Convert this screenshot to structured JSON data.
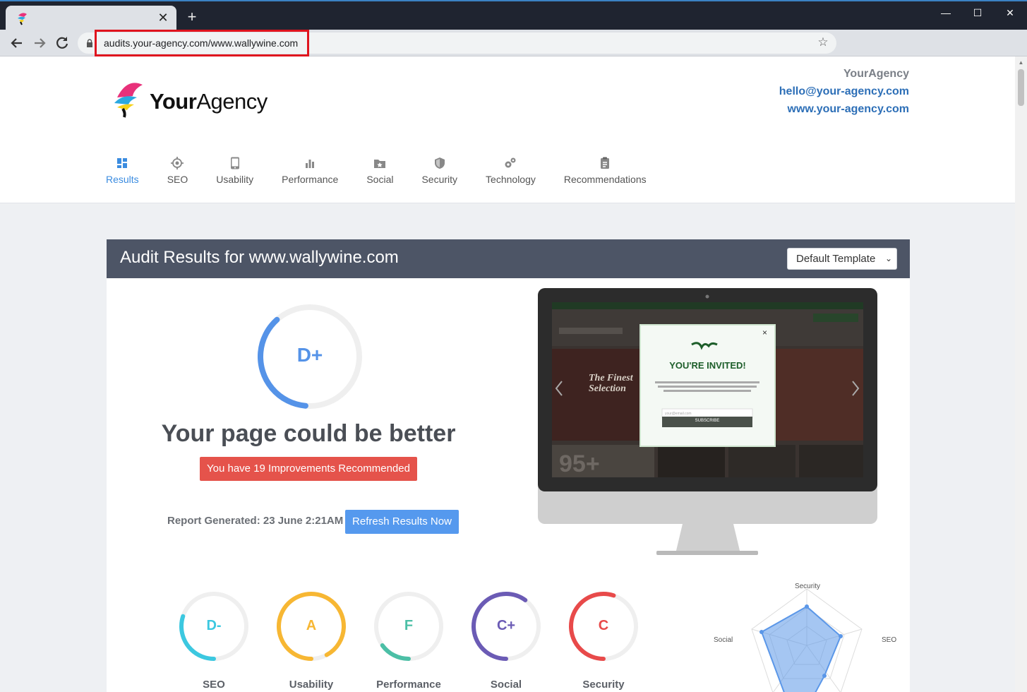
{
  "browser": {
    "url": "audits.your-agency.com/www.wallywine.com",
    "tab_close": "✕",
    "new_tab": "+",
    "window_minimize": "—",
    "window_maximize": "☐",
    "window_close": "✕"
  },
  "agency": {
    "logo_text_bold": "Your",
    "logo_text_light": "Agency",
    "name": "YourAgency",
    "email": "hello@your-agency.com",
    "website": "www.your-agency.com"
  },
  "nav": [
    {
      "label": "Results",
      "icon": "dashboard-icon",
      "active": true
    },
    {
      "label": "SEO",
      "icon": "target-icon"
    },
    {
      "label": "Usability",
      "icon": "tablet-icon"
    },
    {
      "label": "Performance",
      "icon": "bar-chart-icon"
    },
    {
      "label": "Social",
      "icon": "star-folder-icon"
    },
    {
      "label": "Security",
      "icon": "shield-icon"
    },
    {
      "label": "Technology",
      "icon": "gears-icon"
    },
    {
      "label": "Recommendations",
      "icon": "clipboard-icon"
    }
  ],
  "audit": {
    "title": "Audit Results for www.wallywine.com",
    "template_select": "Default Template",
    "overall_grade": "D+",
    "overall_progress": 0.37,
    "headline": "Your page could be better",
    "improvements": "You have 19 Improvements Recommended",
    "report_generated": "Report Generated: 23 June 2:21AM",
    "refresh_label": "Refresh Results Now"
  },
  "preview": {
    "popup_title": "YOU'RE INVITED!",
    "popup_text": "Sign up for our exclusive email list and be the first to hear of special offerings, new arrivals, and events.",
    "popup_placeholder": "your@email.com",
    "popup_button": "SUBSCRIBE",
    "popup_close": "×",
    "hero_text": "The Finest Selection",
    "score_text": "95+"
  },
  "categories": [
    {
      "label": "SEO",
      "grade": "D-",
      "color": "#3cc8e0",
      "progress": 0.3
    },
    {
      "label": "Usability",
      "grade": "A",
      "color": "#f7b733",
      "progress": 0.92
    },
    {
      "label": "Performance",
      "grade": "F",
      "color": "#4cbfa6",
      "progress": 0.15
    },
    {
      "label": "Social",
      "grade": "C+",
      "color": "#6b5bb5",
      "progress": 0.6
    },
    {
      "label": "Security",
      "grade": "C",
      "color": "#e84a4a",
      "progress": 0.55
    }
  ],
  "radar": {
    "axes": [
      "Security",
      "SEO",
      "Social"
    ],
    "color": "#5b97e8"
  },
  "colors": {
    "accent": "#3b8ce0",
    "header_bar": "#4d5566",
    "badge_red": "#e5534b",
    "button_blue": "#5599ee"
  }
}
